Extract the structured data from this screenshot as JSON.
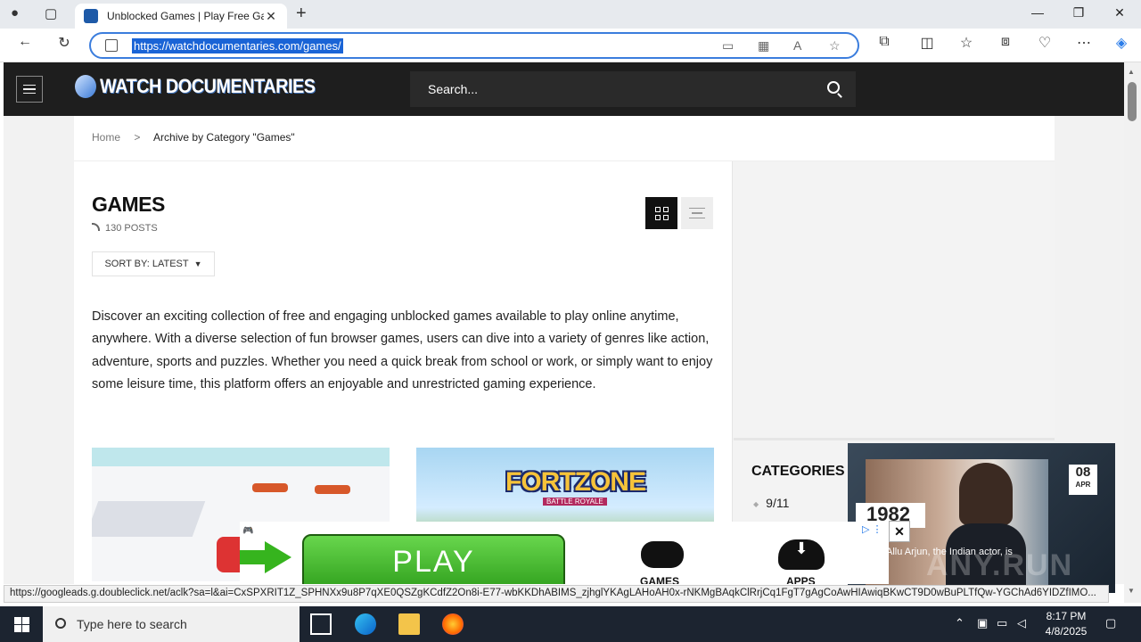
{
  "browser": {
    "tab_title": "Unblocked Games | Play Free Games",
    "url": "https://watchdocumentaries.com/games/"
  },
  "site": {
    "logo_text": "WATCH DOCUMENTARIES",
    "search_placeholder": "Search..."
  },
  "breadcrumb": {
    "home": "Home",
    "separator": ">",
    "current": "Archive by Category \"Games\""
  },
  "archive": {
    "title": "GAMES",
    "post_count": "130 POSTS",
    "sort_label": "SORT BY: LATEST",
    "description": "Discover an exciting collection of free and engaging unblocked games available to play online anytime, anywhere. With a diverse selection of fun browser games, users can dive into a variety of genres like action, adventure, sports and puzzles. Whether you need a quick break from school or work, or simply want to enjoy some leisure time, this platform offers an enjoyable and unrestricted gaming experience."
  },
  "thumbnails": {
    "second_title": "FORTZONE",
    "second_sub": "BATTLE ROYALE"
  },
  "sidebar": {
    "categories_title": "CATEGORIES",
    "categories": [
      "9/11"
    ]
  },
  "video": {
    "day": "08",
    "month": "APR",
    "year": "1982",
    "caption": "Allu Arjun, the Indian actor, is",
    "watermark": "ANY.RUN"
  },
  "ad": {
    "play_label": "PLAY",
    "games_label": "GAMES",
    "apps_label": "APPS"
  },
  "status_url": "https://googleads.g.doubleclick.net/aclk?sa=l&ai=CxSPXRIT1Z_SPHNXx9u8P7qXE0QSZgKCdfZ2On8i-E77-wbKKDhABIMS_zjhglYKAgLAHoAH0x-rNKMgBAqkClRrjCq1FgT7gAgCoAwHIAwiqBKwCT9D0wBuPLTfQw-YGChAd6YIDZfIMO...",
  "taskbar": {
    "search_placeholder": "Type here to search",
    "time": "8:17 PM",
    "date": "4/8/2025"
  },
  "colors": {
    "header_bg": "#1e1e1e",
    "accent_blue": "#1a64d6",
    "play_green": "#2f9f1c"
  }
}
